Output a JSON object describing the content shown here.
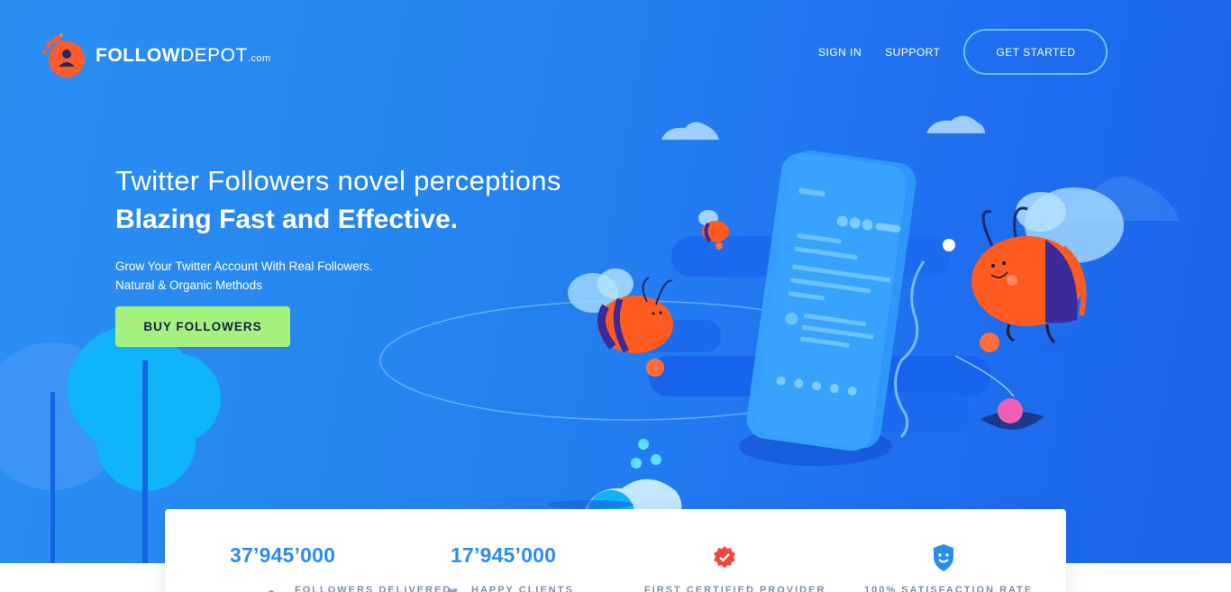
{
  "brand": {
    "name_bold": "FOLLOW",
    "name_regular": "DEPOT",
    "tld": ".com",
    "logo_icon": "user-badge-icon",
    "colors": {
      "accent": "#ff5a2e",
      "cta": "#a6f080",
      "primary": "#2584f0"
    }
  },
  "nav": {
    "sign_in": "SIGN IN",
    "support": "SUPPORT",
    "get_started": "GET STARTED"
  },
  "hero": {
    "title_line1": "Twitter Followers novel perceptions",
    "title_line2": "Blazing Fast and Effective.",
    "subtitle_line1": "Grow Your Twitter Account With Real Followers.",
    "subtitle_line2": "Natural & Organic Methods",
    "cta_label": "BUY FOLLOWERS"
  },
  "stats": [
    {
      "value": "37’945’000",
      "label": "FOLLOWERS DELIVERED",
      "icon": "dot-icon"
    },
    {
      "value": "17’945’000",
      "label": "HAPPY CLIENTS",
      "icon": "heart-icon"
    },
    {
      "value": "",
      "label": "FIRST CERTIFIED PROVIDER",
      "icon": "certified-badge-icon"
    },
    {
      "value": "",
      "label": "100% SATISFACTION RATE",
      "icon": "smiley-shield-icon"
    }
  ]
}
